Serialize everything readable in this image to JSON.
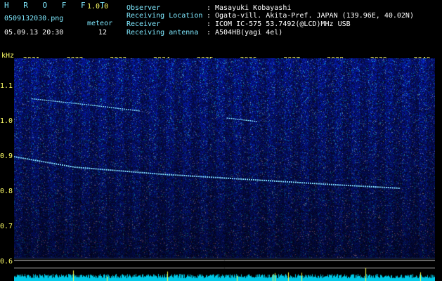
{
  "app": {
    "title": "H R O F F T",
    "version": "1.0.0"
  },
  "file": {
    "name": "0509132030.png",
    "datetime": "05.09.13 20:30"
  },
  "meteor": {
    "label": "meteor",
    "count": "12"
  },
  "info": [
    {
      "key": "Observer",
      "sep": ":",
      "value": "Masayuki Kobayashi"
    },
    {
      "key": "Receiving Location",
      "sep": ":",
      "value": "Ogata-vill. Akita-Pref. JAPAN (139.96E, 40.02N)"
    },
    {
      "key": "Receiver",
      "sep": ":",
      "value": "ICOM IC-575 53.7492(@LCD)MHz USB"
    },
    {
      "key": "Receiving antenna",
      "sep": ":",
      "value": "A504HB(yagi 4el)"
    }
  ],
  "chart_data": {
    "type": "heatmap",
    "ylabel": "kHz",
    "y_ticks": [
      "1.1",
      "1.0",
      "0.9",
      "0.8",
      "0.7",
      "0.6"
    ],
    "x_ticks": [
      "2031",
      "2032",
      "2033",
      "2034",
      "2035",
      "2036",
      "2037",
      "2038",
      "2039",
      "2040"
    ],
    "ylim": [
      0.58,
      1.18
    ],
    "xlim": [
      2030.6,
      2040.3
    ],
    "traces": [
      {
        "points": [
          [
            2030.6,
            0.9
          ],
          [
            2032.0,
            0.87
          ],
          [
            2034.0,
            0.85
          ],
          [
            2036.0,
            0.835
          ],
          [
            2038.0,
            0.82
          ],
          [
            2039.5,
            0.81
          ]
        ]
      },
      {
        "points": [
          [
            2031.0,
            1.065
          ],
          [
            2032.5,
            1.045
          ],
          [
            2033.5,
            1.03
          ]
        ]
      },
      {
        "points": [
          [
            2035.5,
            1.01
          ],
          [
            2036.2,
            1.0
          ]
        ]
      }
    ],
    "colors": {
      "background": "#000033",
      "signal": "#7fdcff"
    }
  }
}
